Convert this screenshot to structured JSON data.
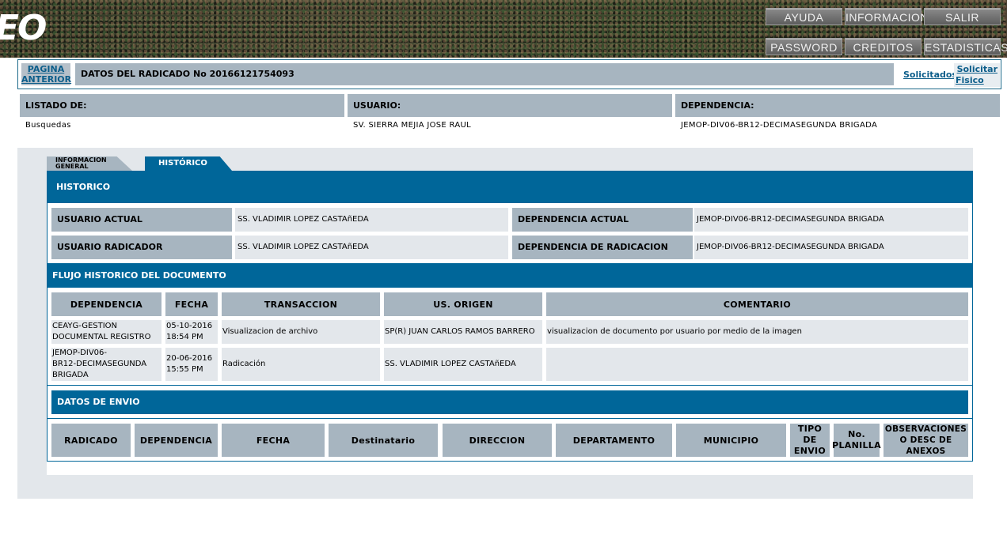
{
  "banner": {
    "logo_text": "EO",
    "nav": {
      "ayuda": "AYUDA",
      "informacion": "INFORMACION",
      "salir": "SALIR",
      "password": "PASSWORD",
      "creditos": "CREDITOS",
      "estadisticas": "ESTADISTICAS"
    }
  },
  "header": {
    "pagina_anterior_line1": "PAGINA",
    "pagina_anterior_line2": "ANTERIOR",
    "title": "DATOS DEL RADICADO No 20166121754093",
    "solicitados": "Solicitados",
    "solicitar_line1": "Solicitar",
    "solicitar_line2": "Fisico"
  },
  "listing": {
    "labels": {
      "listado": "LISTADO DE:",
      "usuario": "USUARIO:",
      "dependencia": "DEPENDENCIA:"
    },
    "values": {
      "listado": "Busquedas",
      "usuario": "SV. SIERRA MEJIA JOSE RAUL",
      "dependencia": "JEMOP-DIV06-BR12-DECIMASEGUNDA BRIGADA"
    }
  },
  "tabs": {
    "info_line1": "INFORMACION",
    "info_line2": "GENERAL",
    "historico": "HISTÓRICO"
  },
  "historico": {
    "title": "HISTORICO",
    "usuario_actual_label": "USUARIO ACTUAL",
    "usuario_actual_value": "SS. VLADIMIR LOPEZ CASTAñEDA",
    "dependencia_actual_label": "DEPENDENCIA ACTUAL",
    "dependencia_actual_value": "JEMOP-DIV06-BR12-DECIMASEGUNDA BRIGADA",
    "usuario_radicador_label": "USUARIO RADICADOR",
    "usuario_radicador_value": "SS. VLADIMIR LOPEZ CASTAñEDA",
    "dependencia_radicacion_label": "DEPENDENCIA DE RADICACION",
    "dependencia_radicacion_value": "JEMOP-DIV06-BR12-DECIMASEGUNDA BRIGADA"
  },
  "flujo": {
    "title": "FLUJO HISTORICO DEL DOCUMENTO",
    "columns": [
      "DEPENDENCIA",
      "FECHA",
      "TRANSACCION",
      "US. ORIGEN",
      "COMENTARIO"
    ],
    "rows": [
      {
        "dependencia_l1": "CEAYG-GESTION",
        "dependencia_l2": "DOCUMENTAL REGISTRO",
        "dependencia_l3": "",
        "fecha_l1": "05-10-2016",
        "fecha_l2": "18:54 PM",
        "transaccion": "Visualizacion de archivo",
        "origen": "SP(R) JUAN CARLOS RAMOS BARRERO",
        "comentario": "visualizacion de documento por usuario por medio de la imagen"
      },
      {
        "dependencia_l1": "JEMOP-DIV06-",
        "dependencia_l2": "BR12-DECIMASEGUNDA",
        "dependencia_l3": "BRIGADA",
        "fecha_l1": "20-06-2016",
        "fecha_l2": "15:55 PM",
        "transaccion": "Radicación",
        "origen": "SS. VLADIMIR LOPEZ CASTAñEDA",
        "comentario": ""
      }
    ]
  },
  "envio": {
    "title": "DATOS DE ENVIO",
    "columns": {
      "radicado": "RADICADO",
      "dependencia": "DEPENDENCIA",
      "fecha": "FECHA",
      "destinatario": "Destinatario",
      "direccion": "DIRECCION",
      "departamento": "DEPARTAMENTO",
      "municipio": "MUNICIPIO",
      "tipo_l1": "TIPO",
      "tipo_l2": "DE",
      "tipo_l3": "ENVIO",
      "planilla_l1": "No.",
      "planilla_l2": "PLANILLA",
      "obs_l1": "OBSERVACIONES",
      "obs_l2": "O DESC DE",
      "obs_l3": "ANEXOS"
    }
  },
  "colors": {
    "accent_blue": "#006699",
    "header_gray": "#a7b5c0",
    "cell_gray": "#e3e7eb",
    "link_blue": "#0c5d8a"
  }
}
